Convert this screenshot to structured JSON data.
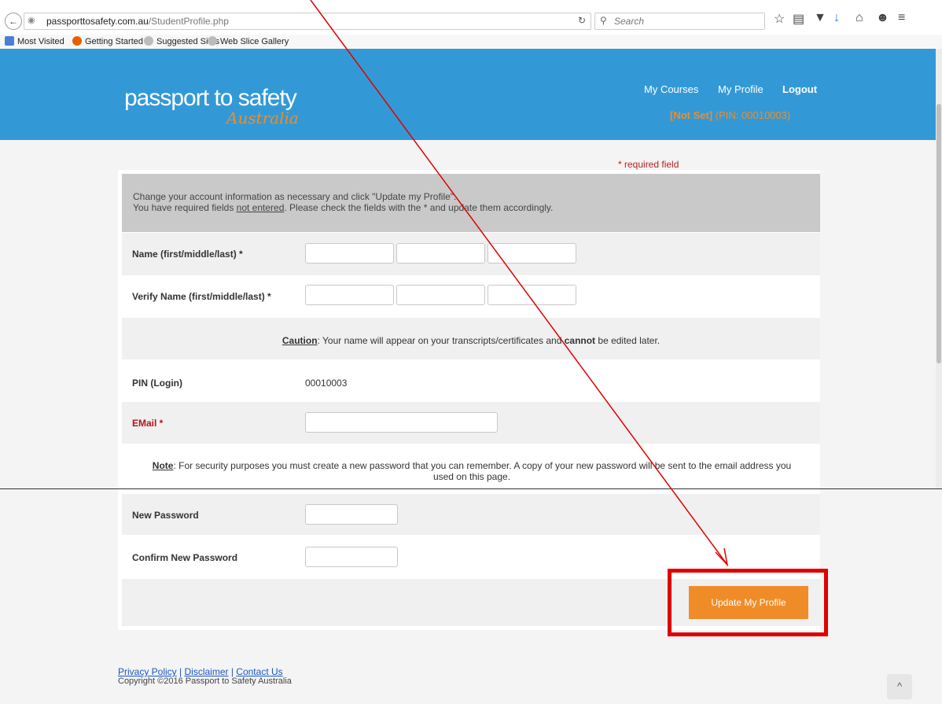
{
  "browser": {
    "url_domain": "passporttosafety.com.au",
    "url_path": "/StudentProfile.php",
    "search_placeholder": "Search",
    "bookmarks": [
      "Most Visited",
      "Getting Started",
      "Suggested Sites",
      "Web Slice Gallery"
    ]
  },
  "header": {
    "logo_main": "passport to safety",
    "logo_sub": "Australia",
    "nav": [
      "My Courses",
      "My Profile",
      "Logout"
    ],
    "user_name": "[Not Set]",
    "pin_text": "(PIN: 00010003)"
  },
  "form": {
    "required_note": "* required field",
    "intro_line1": "Change your account information as necessary and click \"Update my Profile\".",
    "intro_line2_a": "You have required fields ",
    "intro_line2_link": "not entered",
    "intro_line2_b": ". Please check the fields with the * and update them accordingly.",
    "name_label": "Name (first/middle/last) *",
    "verify_name_label": "Verify Name (first/middle/last) *",
    "caution_label": "Caution",
    "caution_text_a": ": Your name will appear on your transcripts/certificates and ",
    "caution_bold": "cannot",
    "caution_text_b": " be edited later.",
    "pin_label": "PIN (Login)",
    "pin_value": "00010003",
    "email_label": "EMail",
    "email_star": " *",
    "note_label": "Note",
    "note_text": ": For security purposes you must create a new password that you can remember. A copy of your new password will be sent to the email address you",
    "note_text2": "used on this page.",
    "new_password_label": "New Password",
    "confirm_password_label": "Confirm New Password",
    "submit_label": "Update My Profile"
  },
  "footer": {
    "links": [
      "Privacy Policy",
      "Disclaimer",
      "Contact Us"
    ],
    "copyright": "Copyright ©2016 Passport to Safety Australia",
    "top_icon": "^"
  },
  "colors": {
    "header_bg": "#3399d6",
    "accent_orange": "#f08c28",
    "highlight_red": "#e00000"
  }
}
